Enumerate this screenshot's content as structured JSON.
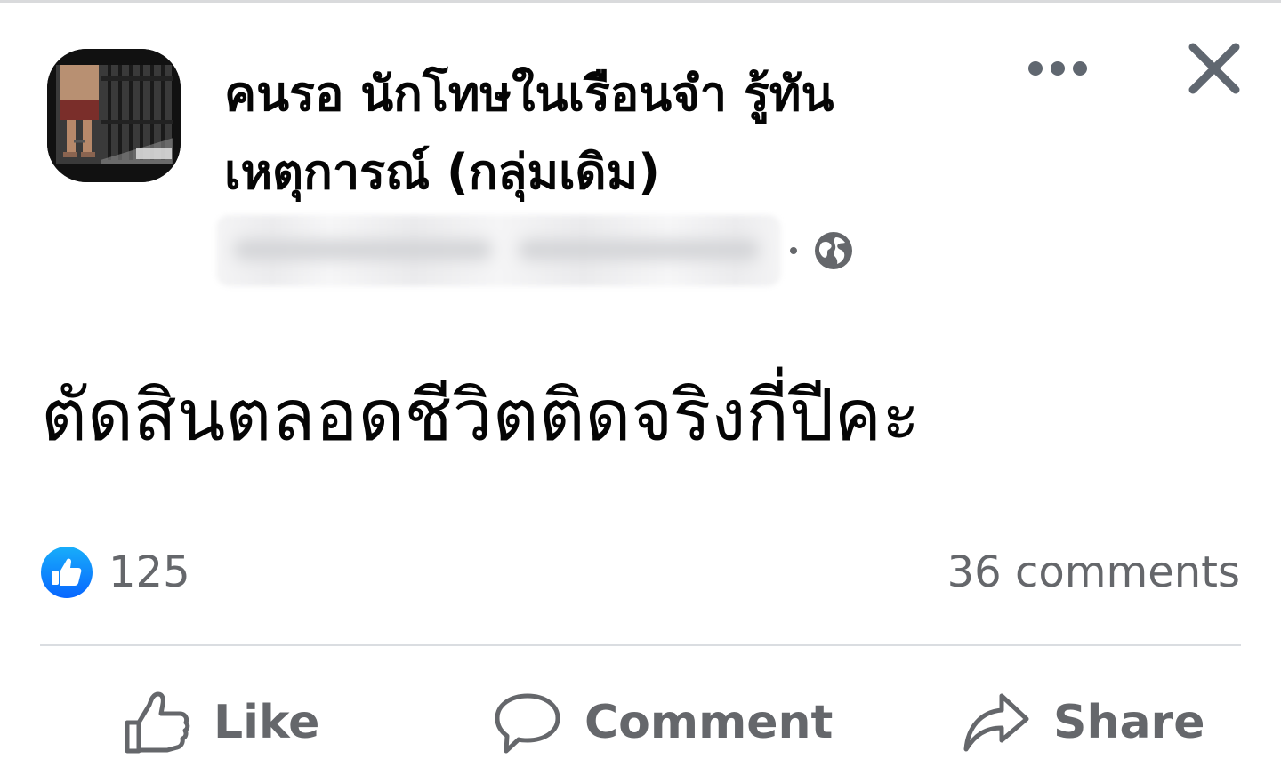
{
  "post": {
    "group_name": "คนรอ นักโทษในเรือนจำ รู้ทัน เหตุการณ์ (กลุ่มเดิม)",
    "author_meta_blurred": "",
    "meta_separator": "·",
    "privacy_icon": "globe-icon",
    "header_icons": [
      "more-options-icon",
      "close-icon"
    ],
    "text": "ตัดสินตลอดชีวิตติดจริงกี่ปีคะ"
  },
  "reactions": {
    "reaction_icon": "like-reaction-icon",
    "count": "125",
    "comments": "36 comments"
  },
  "actions": {
    "like_label": "Like",
    "comment_label": "Comment",
    "share_label": "Share"
  },
  "colors": {
    "text_primary": "#050505",
    "text_secondary": "#65676b",
    "like_blue": "#1877f2",
    "divider": "#dadde1"
  }
}
